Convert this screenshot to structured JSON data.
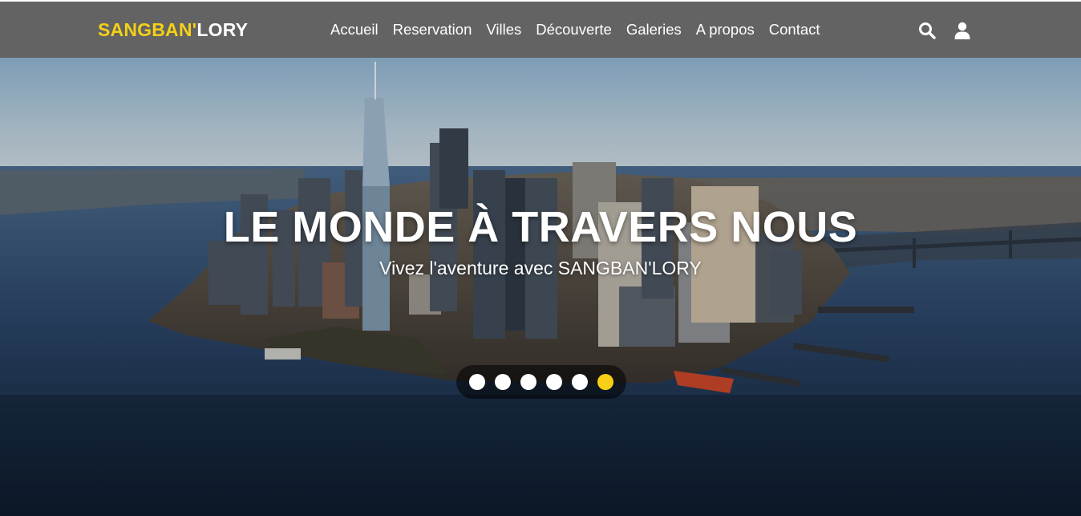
{
  "header": {
    "brand_part1": "SANGBAN'",
    "brand_part2": "LORY",
    "nav": [
      "Accueil",
      "Reservation",
      "Villes",
      "Découverte",
      "Galeries",
      "A propos",
      "Contact"
    ],
    "icons": [
      "search-icon",
      "user-icon"
    ]
  },
  "hero": {
    "title": "LE MONDE À TRAVERS NOUS",
    "subtitle": "Vivez l'aventure avec SANGBAN'LORY",
    "slides_count": 6,
    "active_slide": 6
  },
  "colors": {
    "header_bg": "#636363",
    "accent": "#f5d016",
    "text": "#ffffff"
  }
}
